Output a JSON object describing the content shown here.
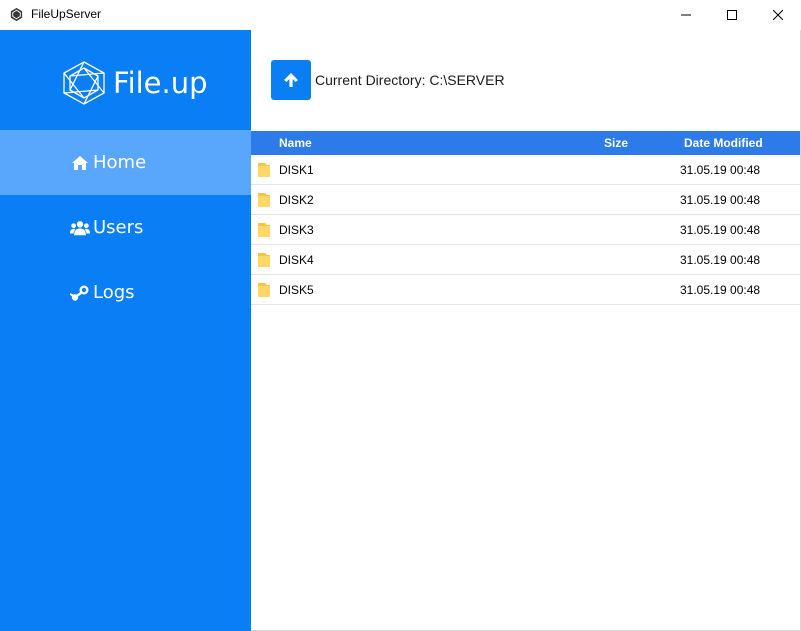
{
  "window": {
    "title": "FileUpServer",
    "icon": "hexagon-logo-icon"
  },
  "sidebar": {
    "brand": "File.up",
    "items": [
      {
        "label": "Home",
        "icon": "home-icon",
        "active": true
      },
      {
        "label": "Users",
        "icon": "users-icon",
        "active": false
      },
      {
        "label": "Logs",
        "icon": "steam-icon",
        "active": false
      }
    ]
  },
  "toolbar": {
    "up_icon": "arrow-up-icon",
    "current_directory": "Current Directory: C:\\SERVER"
  },
  "table": {
    "columns": [
      "Name",
      "Size",
      "Date Modified"
    ],
    "rows": [
      {
        "name": "DISK1",
        "size": "",
        "date": "31.05.19 00:48"
      },
      {
        "name": "DISK2",
        "size": "",
        "date": "31.05.19 00:48"
      },
      {
        "name": "DISK3",
        "size": "",
        "date": "31.05.19 00:48"
      },
      {
        "name": "DISK4",
        "size": "",
        "date": "31.05.19 00:48"
      },
      {
        "name": "DISK5",
        "size": "",
        "date": "31.05.19 00:48"
      }
    ]
  },
  "colors": {
    "sidebar": "#0a7ef5",
    "sidebar_active": "#59a7fc",
    "table_header": "#2d7be8",
    "folder": "#f5c542"
  }
}
